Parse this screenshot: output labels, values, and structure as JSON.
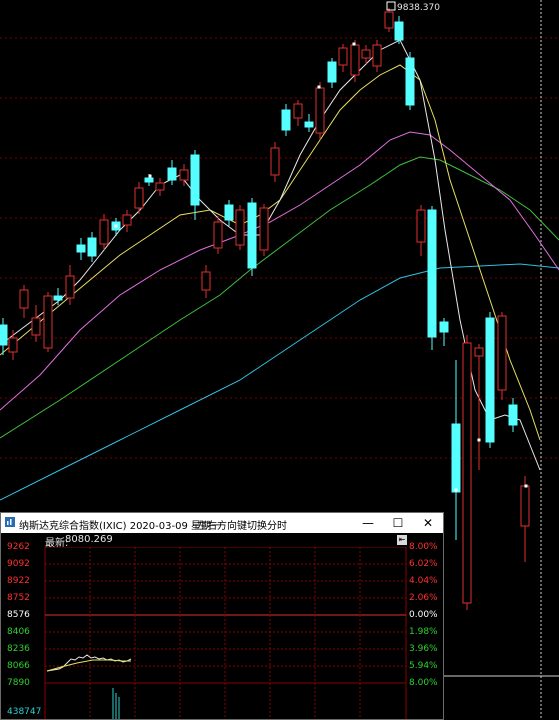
{
  "main_chart": {
    "high_label": "9838.370",
    "colors": {
      "bg": "#000000",
      "up": "#e03030",
      "down": "#55ffff",
      "ma5": "#e8e8e8",
      "ma10": "#e8e060",
      "ma20": "#e070e0",
      "ma30": "#40c040",
      "ma60": "#30c0e0",
      "grid": "#7a0000"
    }
  },
  "popup": {
    "title": "纳斯达克综合指数(IXIC) 2020-03-09 星期一",
    "hint": "左右方向键切换分时",
    "min_btn": "—",
    "max_btn": "☐",
    "close_btn": "✕",
    "latest_label": "最新:",
    "latest_value": "8080.269",
    "arrow_icon": "⇤",
    "left_labels": [
      {
        "text": "9262",
        "color": "#ff3030"
      },
      {
        "text": "9092",
        "color": "#ff3030"
      },
      {
        "text": "8922",
        "color": "#ff3030"
      },
      {
        "text": "8752",
        "color": "#ff3030"
      },
      {
        "text": "8576",
        "color": "#ffffff"
      },
      {
        "text": "8406",
        "color": "#30d030"
      },
      {
        "text": "8236",
        "color": "#30d030"
      },
      {
        "text": "8066",
        "color": "#30d030"
      },
      {
        "text": "7890",
        "color": "#30d030"
      },
      {
        "text": "438747",
        "color": "#30d0d0"
      }
    ],
    "right_labels": [
      {
        "text": "8.00%",
        "color": "#ff3030"
      },
      {
        "text": "6.02%",
        "color": "#ff3030"
      },
      {
        "text": "4.04%",
        "color": "#ff3030"
      },
      {
        "text": "2.06%",
        "color": "#ff3030"
      },
      {
        "text": "0.00%",
        "color": "#ffffff"
      },
      {
        "text": "1.98%",
        "color": "#30d030"
      },
      {
        "text": "3.96%",
        "color": "#30d030"
      },
      {
        "text": "5.94%",
        "color": "#30d030"
      },
      {
        "text": "8.00%",
        "color": "#30d030"
      }
    ]
  }
}
